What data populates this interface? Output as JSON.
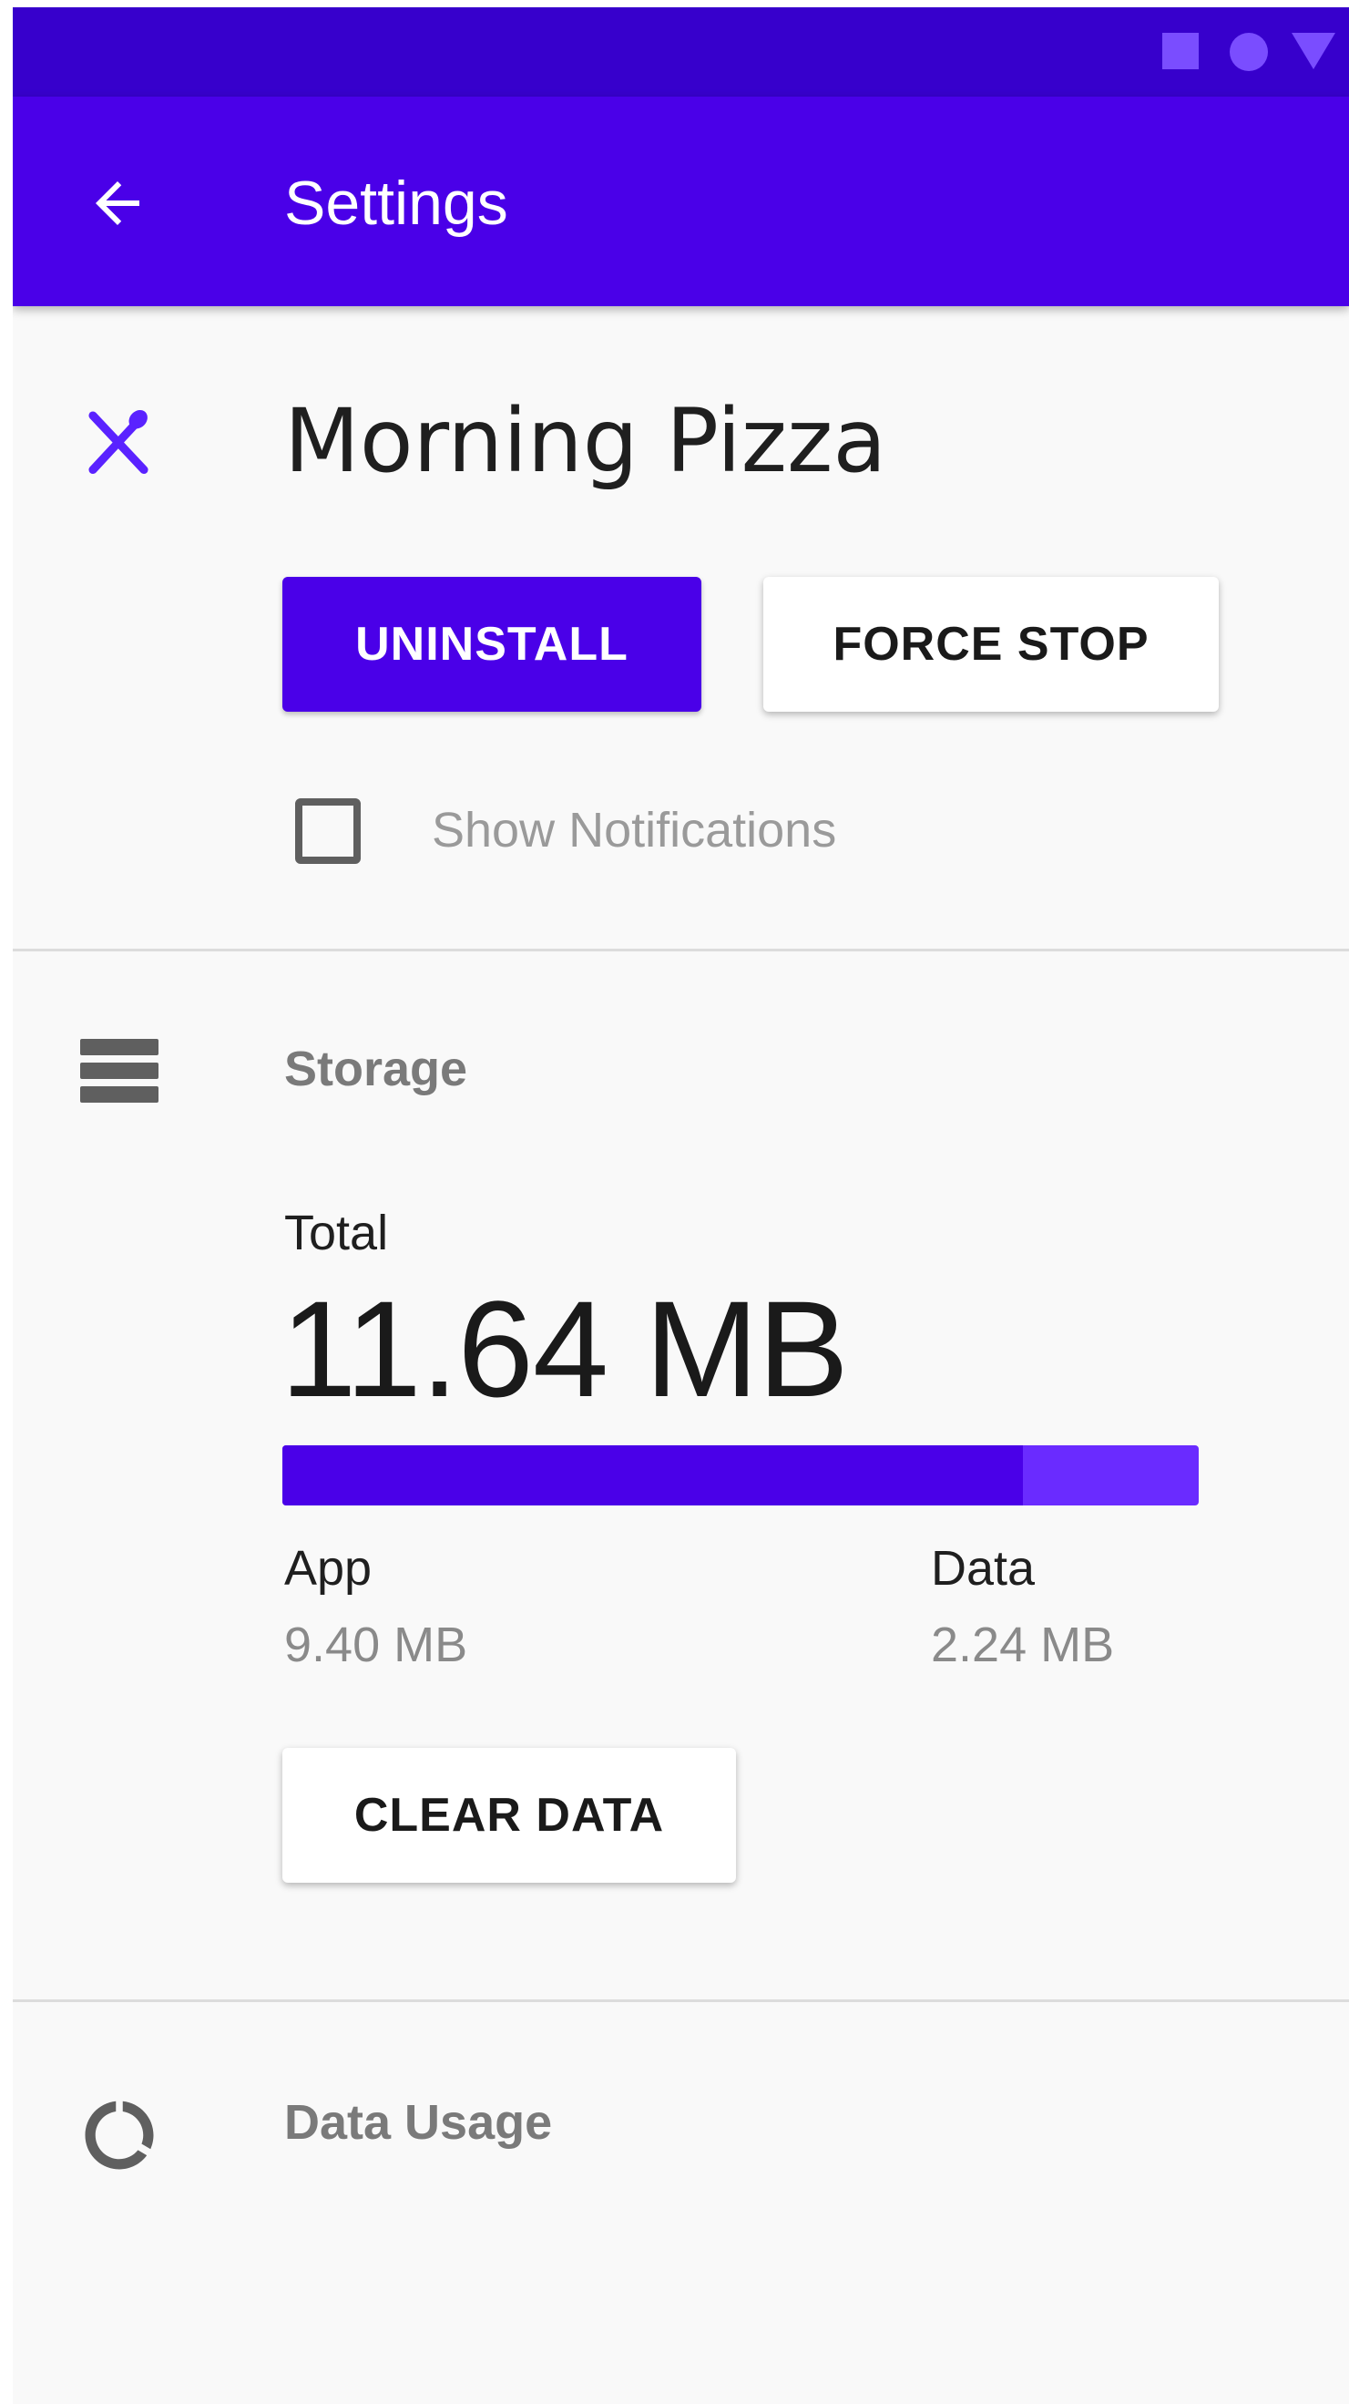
{
  "status_bar": {
    "icons": [
      "square-icon",
      "circle-icon",
      "triangle-icon"
    ]
  },
  "app_bar": {
    "title": "Settings",
    "back_icon": "arrow-back-icon"
  },
  "app_info": {
    "icon": "restaurant-icon",
    "name": "Morning Pizza",
    "uninstall_label": "UNINSTALL",
    "force_stop_label": "FORCE STOP",
    "show_notifications_label": "Show Notifications",
    "show_notifications_checked": false
  },
  "storage": {
    "icon": "storage-icon",
    "title": "Storage",
    "total_label": "Total",
    "total_value": "11.64 MB",
    "app_share": 0.808,
    "app_label": "App",
    "app_value": "9.40 MB",
    "data_label": "Data",
    "data_value": "2.24 MB",
    "clear_data_label": "CLEAR DATA"
  },
  "data_usage": {
    "icon": "data-usage-icon",
    "title": "Data Usage"
  },
  "colors": {
    "primary": "#4a00e8",
    "primary_dark": "#3700cc",
    "secondary_fill": "#6a2bff",
    "background": "#f9f9f9"
  }
}
